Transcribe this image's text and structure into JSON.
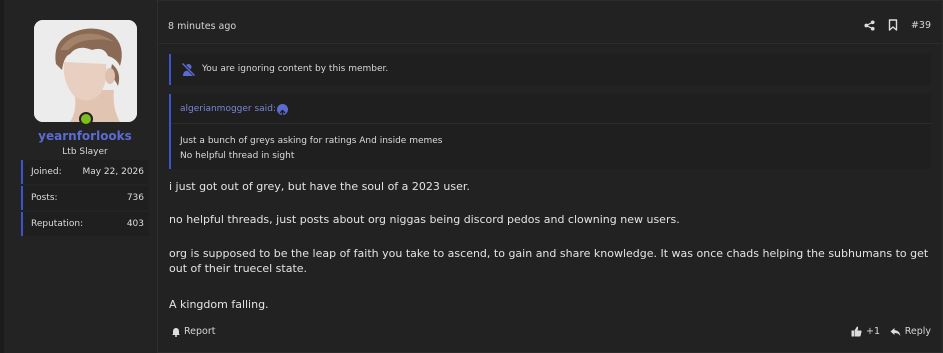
{
  "user": {
    "username": "yearnforlooks",
    "title": "Ltb Slayer",
    "stats": [
      {
        "label": "Joined:",
        "value": "May 22, 2026"
      },
      {
        "label": "Posts:",
        "value": "736"
      },
      {
        "label": "Reputation:",
        "value": "403"
      }
    ]
  },
  "header": {
    "time": "8 minutes ago",
    "post_number": "#39"
  },
  "ignored_notice": "You are ignoring content by this member.",
  "quote": {
    "author": "algerianmogger said:",
    "lines": [
      "Just a bunch of greys asking for ratings And inside memes",
      "No helpful thread in sight"
    ]
  },
  "body": [
    "i just got out of grey, but have the soul of a 2023 user.",
    "no helpful threads, just posts about org niggas being discord pedos and clowning new users.",
    "org is supposed to be the leap of faith you take to ascend, to gain and share knowledge. It was once chads helping the subhumans to get out of their truecel state.",
    "A kingdom falling."
  ],
  "footer": {
    "report": "Report",
    "reaction": "+1",
    "reply": "Reply"
  },
  "colors": {
    "accent": "#3f53c8",
    "username": "#5b6bd1",
    "online": "#7cbf1d",
    "background": "#222222"
  }
}
